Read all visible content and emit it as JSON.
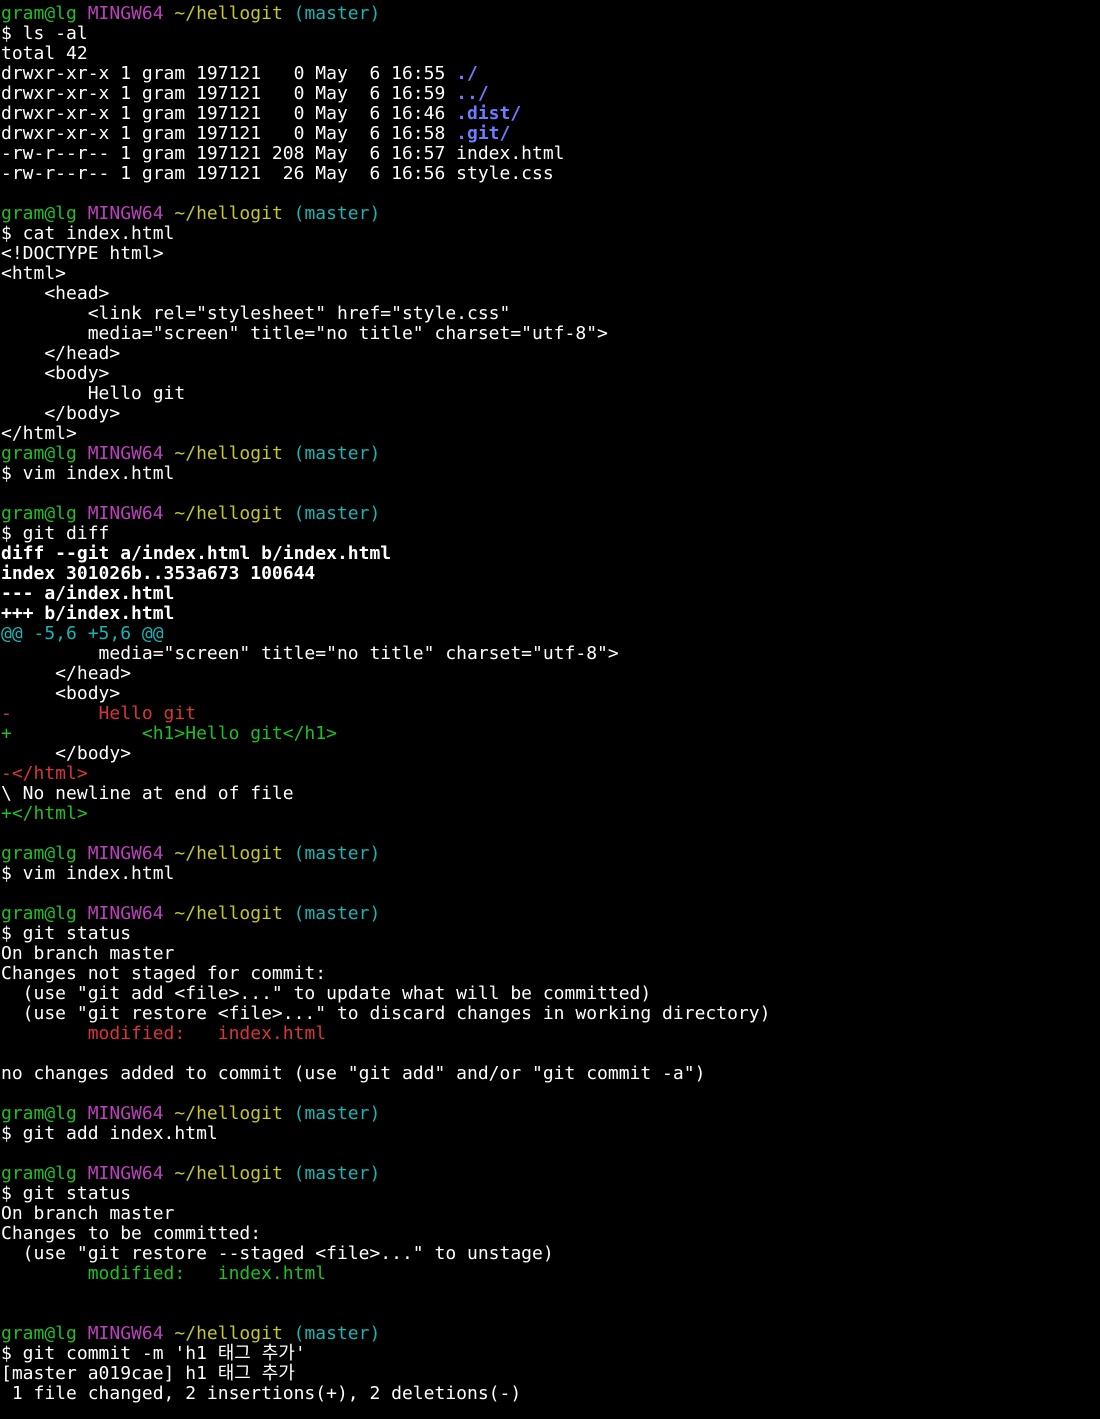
{
  "colors": {
    "background": "#000000",
    "foreground": "#ffffff",
    "user_host": "#1dc121",
    "shell_name": "#bc3fbc",
    "path": "#c7c729",
    "branch": "#16b6b6",
    "removed": "#d9343c",
    "added": "#1dc121",
    "directory": "#6c7cff"
  },
  "lines": [
    {
      "segs": [
        [
          "g",
          "gram@lg"
        ],
        [
          "w",
          " "
        ],
        [
          "m",
          "MINGW64"
        ],
        [
          "w",
          " "
        ],
        [
          "y",
          "~/hellogit"
        ],
        [
          "w",
          " "
        ],
        [
          "c",
          "(master)"
        ]
      ]
    },
    {
      "segs": [
        [
          "w",
          "$ ls -al"
        ]
      ]
    },
    {
      "segs": [
        [
          "w",
          "total 42"
        ]
      ]
    },
    {
      "segs": [
        [
          "w",
          "drwxr-xr-x 1 gram 197121   0 May  6 16:55 "
        ],
        [
          "b",
          "./"
        ]
      ]
    },
    {
      "segs": [
        [
          "w",
          "drwxr-xr-x 1 gram 197121   0 May  6 16:59 "
        ],
        [
          "b",
          "../"
        ]
      ]
    },
    {
      "segs": [
        [
          "w",
          "drwxr-xr-x 1 gram 197121   0 May  6 16:46 "
        ],
        [
          "b",
          ".dist/"
        ]
      ]
    },
    {
      "segs": [
        [
          "w",
          "drwxr-xr-x 1 gram 197121   0 May  6 16:58 "
        ],
        [
          "b",
          ".git/"
        ]
      ]
    },
    {
      "segs": [
        [
          "w",
          "-rw-r--r-- 1 gram 197121 208 May  6 16:57 index.html"
        ]
      ]
    },
    {
      "segs": [
        [
          "w",
          "-rw-r--r-- 1 gram 197121  26 May  6 16:56 style.css"
        ]
      ]
    },
    {
      "segs": []
    },
    {
      "segs": [
        [
          "g",
          "gram@lg"
        ],
        [
          "w",
          " "
        ],
        [
          "m",
          "MINGW64"
        ],
        [
          "w",
          " "
        ],
        [
          "y",
          "~/hellogit"
        ],
        [
          "w",
          " "
        ],
        [
          "c",
          "(master)"
        ]
      ]
    },
    {
      "segs": [
        [
          "w",
          "$ cat index.html"
        ]
      ]
    },
    {
      "segs": [
        [
          "w",
          "<!DOCTYPE html>"
        ]
      ]
    },
    {
      "segs": [
        [
          "w",
          "<html>"
        ]
      ]
    },
    {
      "segs": [
        [
          "w",
          "    <head>"
        ]
      ]
    },
    {
      "segs": [
        [
          "w",
          "        <link rel=\"stylesheet\" href=\"style.css\""
        ]
      ]
    },
    {
      "segs": [
        [
          "w",
          "        media=\"screen\" title=\"no title\" charset=\"utf-8\">"
        ]
      ]
    },
    {
      "segs": [
        [
          "w",
          "    </head>"
        ]
      ]
    },
    {
      "segs": [
        [
          "w",
          "    <body>"
        ]
      ]
    },
    {
      "segs": [
        [
          "w",
          "        Hello git"
        ]
      ]
    },
    {
      "segs": [
        [
          "w",
          "    </body>"
        ]
      ]
    },
    {
      "segs": [
        [
          "w",
          "</html>"
        ]
      ]
    },
    {
      "segs": [
        [
          "g",
          "gram@lg"
        ],
        [
          "w",
          " "
        ],
        [
          "m",
          "MINGW64"
        ],
        [
          "w",
          " "
        ],
        [
          "y",
          "~/hellogit"
        ],
        [
          "w",
          " "
        ],
        [
          "c",
          "(master)"
        ]
      ]
    },
    {
      "segs": [
        [
          "w",
          "$ vim index.html"
        ]
      ]
    },
    {
      "segs": []
    },
    {
      "segs": [
        [
          "g",
          "gram@lg"
        ],
        [
          "w",
          " "
        ],
        [
          "m",
          "MINGW64"
        ],
        [
          "w",
          " "
        ],
        [
          "y",
          "~/hellogit"
        ],
        [
          "w",
          " "
        ],
        [
          "c",
          "(master)"
        ]
      ]
    },
    {
      "segs": [
        [
          "w",
          "$ git diff"
        ]
      ]
    },
    {
      "segs": [
        [
          "bold",
          "diff --git a/index.html b/index.html"
        ]
      ]
    },
    {
      "segs": [
        [
          "bold",
          "index 301026b..353a673 100644"
        ]
      ]
    },
    {
      "segs": [
        [
          "bold",
          "--- a/index.html"
        ]
      ]
    },
    {
      "segs": [
        [
          "bold",
          "+++ b/index.html"
        ]
      ]
    },
    {
      "segs": [
        [
          "c",
          "@@ -5,6 +5,6 @@"
        ]
      ]
    },
    {
      "segs": [
        [
          "w",
          "         media=\"screen\" title=\"no title\" charset=\"utf-8\">"
        ]
      ]
    },
    {
      "segs": [
        [
          "w",
          "     </head>"
        ]
      ]
    },
    {
      "segs": [
        [
          "w",
          "     <body>"
        ]
      ]
    },
    {
      "segs": [
        [
          "r",
          "-        Hello git"
        ]
      ]
    },
    {
      "segs": [
        [
          "g",
          "+            <h1>Hello git</h1>"
        ]
      ]
    },
    {
      "segs": [
        [
          "w",
          "     </body>"
        ]
      ]
    },
    {
      "segs": [
        [
          "r",
          "-</html>"
        ]
      ]
    },
    {
      "segs": [
        [
          "w",
          "\\ No newline at end of file"
        ]
      ]
    },
    {
      "segs": [
        [
          "g",
          "+</html>"
        ]
      ]
    },
    {
      "segs": []
    },
    {
      "segs": [
        [
          "g",
          "gram@lg"
        ],
        [
          "w",
          " "
        ],
        [
          "m",
          "MINGW64"
        ],
        [
          "w",
          " "
        ],
        [
          "y",
          "~/hellogit"
        ],
        [
          "w",
          " "
        ],
        [
          "c",
          "(master)"
        ]
      ]
    },
    {
      "segs": [
        [
          "w",
          "$ vim index.html"
        ]
      ]
    },
    {
      "segs": []
    },
    {
      "segs": [
        [
          "g",
          "gram@lg"
        ],
        [
          "w",
          " "
        ],
        [
          "m",
          "MINGW64"
        ],
        [
          "w",
          " "
        ],
        [
          "y",
          "~/hellogit"
        ],
        [
          "w",
          " "
        ],
        [
          "c",
          "(master)"
        ]
      ]
    },
    {
      "segs": [
        [
          "w",
          "$ git status"
        ]
      ]
    },
    {
      "segs": [
        [
          "w",
          "On branch master"
        ]
      ]
    },
    {
      "segs": [
        [
          "w",
          "Changes not staged for commit:"
        ]
      ]
    },
    {
      "segs": [
        [
          "w",
          "  (use \"git add <file>...\" to update what will be committed)"
        ]
      ]
    },
    {
      "segs": [
        [
          "w",
          "  (use \"git restore <file>...\" to discard changes in working directory)"
        ]
      ]
    },
    {
      "segs": [
        [
          "w",
          "        "
        ],
        [
          "r",
          "modified:   index.html"
        ]
      ]
    },
    {
      "segs": []
    },
    {
      "segs": [
        [
          "w",
          "no changes added to commit (use \"git add\" and/or \"git commit -a\")"
        ]
      ]
    },
    {
      "segs": []
    },
    {
      "segs": [
        [
          "g",
          "gram@lg"
        ],
        [
          "w",
          " "
        ],
        [
          "m",
          "MINGW64"
        ],
        [
          "w",
          " "
        ],
        [
          "y",
          "~/hellogit"
        ],
        [
          "w",
          " "
        ],
        [
          "c",
          "(master)"
        ]
      ]
    },
    {
      "segs": [
        [
          "w",
          "$ git add index.html"
        ]
      ]
    },
    {
      "segs": []
    },
    {
      "segs": [
        [
          "g",
          "gram@lg"
        ],
        [
          "w",
          " "
        ],
        [
          "m",
          "MINGW64"
        ],
        [
          "w",
          " "
        ],
        [
          "y",
          "~/hellogit"
        ],
        [
          "w",
          " "
        ],
        [
          "c",
          "(master)"
        ]
      ]
    },
    {
      "segs": [
        [
          "w",
          "$ git status"
        ]
      ]
    },
    {
      "segs": [
        [
          "w",
          "On branch master"
        ]
      ]
    },
    {
      "segs": [
        [
          "w",
          "Changes to be committed:"
        ]
      ]
    },
    {
      "segs": [
        [
          "w",
          "  (use \"git restore --staged <file>...\" to unstage)"
        ]
      ]
    },
    {
      "segs": [
        [
          "w",
          "        "
        ],
        [
          "g",
          "modified:   index.html"
        ]
      ]
    },
    {
      "segs": []
    },
    {
      "segs": []
    },
    {
      "segs": [
        [
          "g",
          "gram@lg"
        ],
        [
          "w",
          " "
        ],
        [
          "m",
          "MINGW64"
        ],
        [
          "w",
          " "
        ],
        [
          "y",
          "~/hellogit"
        ],
        [
          "w",
          " "
        ],
        [
          "c",
          "(master)"
        ]
      ]
    },
    {
      "segs": [
        [
          "w",
          "$ git commit -m 'h1 태그 추가'"
        ]
      ]
    },
    {
      "segs": [
        [
          "w",
          "[master a019cae] h1 태그 추가"
        ]
      ]
    },
    {
      "segs": [
        [
          "w",
          " 1 file changed, 2 insertions(+), 2 deletions(-)"
        ]
      ]
    }
  ]
}
